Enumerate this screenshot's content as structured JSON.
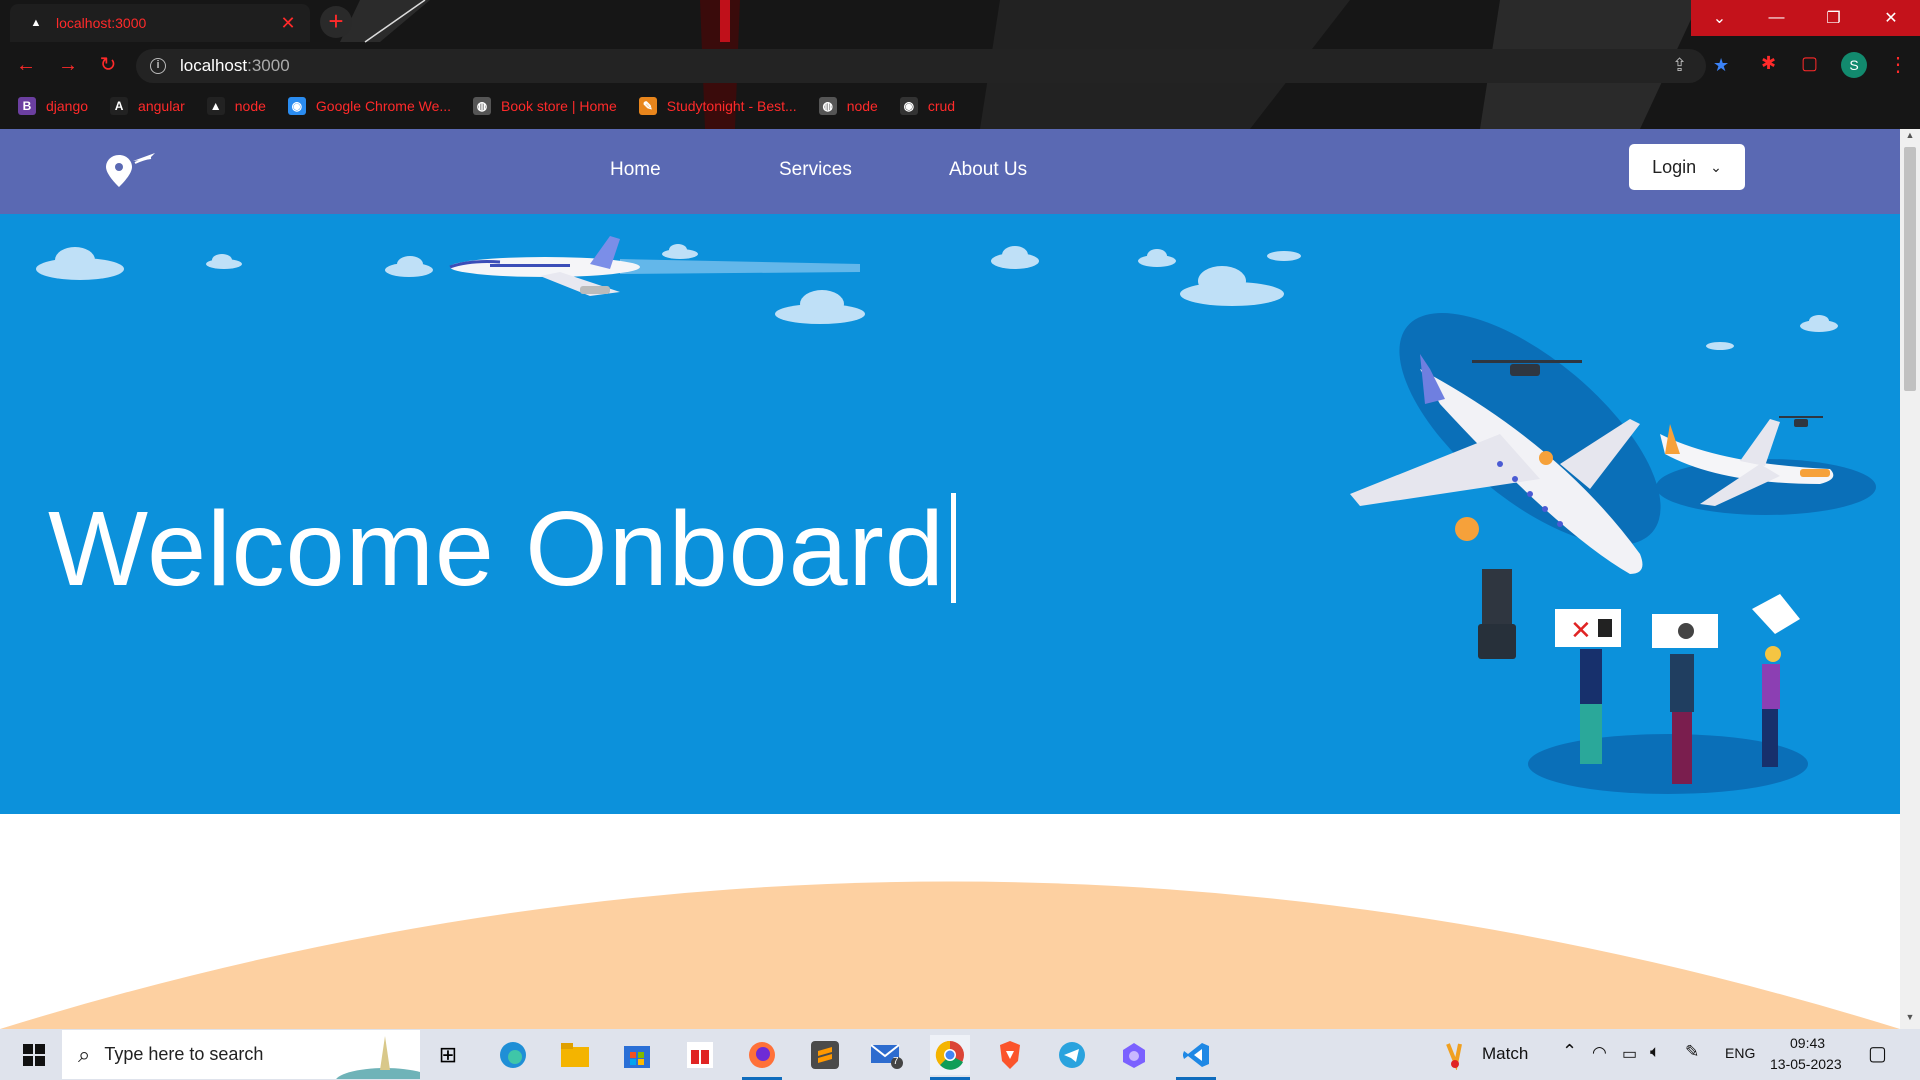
{
  "browser": {
    "tab_title": "localhost:3000",
    "new_tab_label": "+",
    "tab_close_label": "✕",
    "url_host": "localhost",
    "url_port": ":3000",
    "profile_initial": "S",
    "bookmarks": [
      {
        "label": "django",
        "icon": "B",
        "color": "#6b3fa0"
      },
      {
        "label": "angular",
        "icon": "A",
        "color": "#222222"
      },
      {
        "label": "node",
        "icon": "▲",
        "color": "#222222"
      },
      {
        "label": "Google Chrome We...",
        "icon": "◉",
        "color": "#2a8cf0"
      },
      {
        "label": "Book store | Home",
        "icon": "◍",
        "color": "#555555"
      },
      {
        "label": "Studytonight - Best...",
        "icon": "✎",
        "color": "#e8851c"
      },
      {
        "label": "node",
        "icon": "◍",
        "color": "#555555"
      },
      {
        "label": "crud",
        "icon": "◉",
        "color": "#ffffff"
      }
    ]
  },
  "site": {
    "nav": {
      "home": "Home",
      "services": "Services",
      "about": "About Us",
      "login": "Login"
    },
    "hero_title": "Welcome Onboard"
  },
  "taskbar": {
    "search_placeholder": "Type here to search",
    "weather_label": "Match",
    "language": "ENG",
    "time": "09:43",
    "date": "13-05-2023",
    "mail_badge": "7"
  },
  "colors": {
    "navbar": "#5a69b3",
    "hero": "#0c91db",
    "accent_red": "#ff2a2a",
    "peach": "#fdd0a1"
  }
}
